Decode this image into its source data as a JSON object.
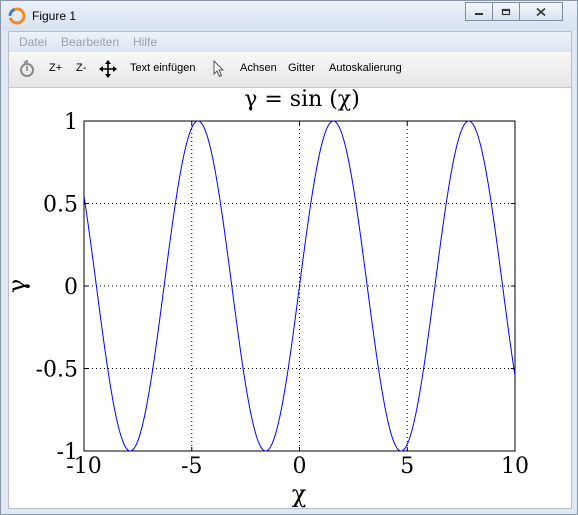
{
  "window": {
    "title": "Figure 1"
  },
  "menu": {
    "items": [
      "Datei",
      "Bearbeiten",
      "Hilfe"
    ]
  },
  "toolbar": {
    "zoom_in": "Z+",
    "zoom_out": "Z-",
    "insert_text": "Text einfügen",
    "axes": "Achsen",
    "grid": "Gitter",
    "autoscale": "Autoskalierung"
  },
  "chart_data": {
    "type": "line",
    "title": "γ = sin (χ)",
    "xlabel": "χ",
    "ylabel": "γ",
    "xlim": [
      -10,
      10
    ],
    "ylim": [
      -1,
      1
    ],
    "xticks": [
      "-10",
      "-5",
      "0",
      "5",
      "10"
    ],
    "yticks": [
      "1",
      "0.5",
      "0",
      "-0.5",
      "-1"
    ],
    "grid": true,
    "series": [
      {
        "function": "sin(x)",
        "x_range": [
          -10,
          10
        ],
        "color": "#0000ff"
      }
    ]
  }
}
